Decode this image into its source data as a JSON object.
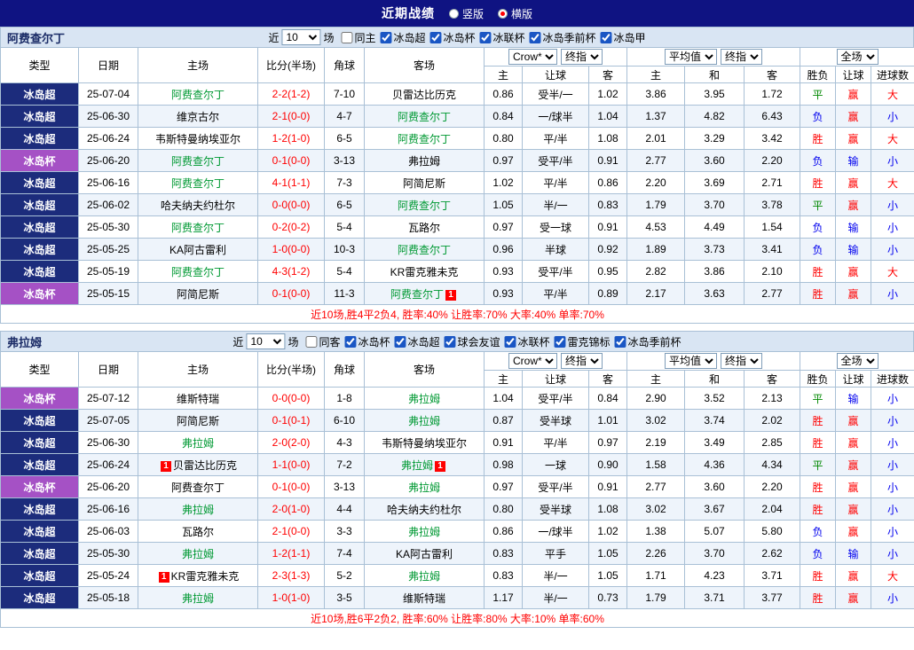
{
  "colors": {
    "topbar_bg": "#0f1382",
    "section_bar_bg": "#d9e5f3",
    "grid_border": "#a9c0d6",
    "row_alt_bg": "#eef4fb",
    "league_super_bg": "#1c2c7c",
    "league_cup_bg": "#a551c5",
    "team_green": "#009933",
    "red": "#ff0000",
    "green": "#008800",
    "blue": "#0000ee"
  },
  "top_bar": {
    "title": "近期战绩",
    "options": [
      {
        "label": "竖版",
        "selected": false
      },
      {
        "label": "横版",
        "selected": true
      }
    ]
  },
  "labels": {
    "near": "近",
    "games": "场"
  },
  "table_header": {
    "type": "类型",
    "date": "日期",
    "home": "主场",
    "score": "比分(半场)",
    "corner": "角球",
    "away": "客场",
    "ah_home": "主",
    "ah_line": "让球",
    "ah_away": "客",
    "eu_home": "主",
    "eu_draw": "和",
    "eu_away": "客",
    "result": "胜负",
    "handicap_result": "让球",
    "goals": "进球数",
    "selects": {
      "ah_company": "Crow*",
      "ah_stage": "终指",
      "eu_company": "平均值",
      "eu_stage": "终指",
      "scope": "全场"
    }
  },
  "sections": [
    {
      "team": "阿费查尔丁",
      "filter": {
        "count": "10",
        "checkboxes": [
          {
            "label": "同主",
            "checked": false
          },
          {
            "label": "冰岛超",
            "checked": true
          },
          {
            "label": "冰岛杯",
            "checked": true
          },
          {
            "label": "冰联杯",
            "checked": true
          },
          {
            "label": "冰岛季前杯",
            "checked": true
          },
          {
            "label": "冰岛甲",
            "checked": true
          }
        ]
      },
      "rows": [
        {
          "league": "冰岛超",
          "league_type": "super",
          "date": "25-07-04",
          "home": "阿费查尔丁",
          "home_team": true,
          "home_card": "",
          "score": "2-2(1-2)",
          "corner": "7-10",
          "away": "贝雷达比历克",
          "away_team": false,
          "away_card": "",
          "ah": [
            "0.86",
            "受半/一",
            "1.02"
          ],
          "eu": [
            "3.86",
            "3.95",
            "1.72"
          ],
          "res": [
            "平",
            "赢",
            "大"
          ]
        },
        {
          "league": "冰岛超",
          "league_type": "super",
          "date": "25-06-30",
          "home": "维京古尔",
          "home_team": false,
          "home_card": "",
          "score": "2-1(0-0)",
          "corner": "4-7",
          "away": "阿费查尔丁",
          "away_team": true,
          "away_card": "",
          "ah": [
            "0.84",
            "一/球半",
            "1.04"
          ],
          "eu": [
            "1.37",
            "4.82",
            "6.43"
          ],
          "res": [
            "负",
            "赢",
            "小"
          ]
        },
        {
          "league": "冰岛超",
          "league_type": "super",
          "date": "25-06-24",
          "home": "韦斯特曼纳埃亚尔",
          "home_team": false,
          "home_card": "",
          "score": "1-2(1-0)",
          "corner": "6-5",
          "away": "阿费查尔丁",
          "away_team": true,
          "away_card": "",
          "ah": [
            "0.80",
            "平/半",
            "1.08"
          ],
          "eu": [
            "2.01",
            "3.29",
            "3.42"
          ],
          "res": [
            "胜",
            "赢",
            "大"
          ]
        },
        {
          "league": "冰岛杯",
          "league_type": "cup",
          "date": "25-06-20",
          "home": "阿费查尔丁",
          "home_team": true,
          "home_card": "",
          "score": "0-1(0-0)",
          "corner": "3-13",
          "away": "弗拉姆",
          "away_team": false,
          "away_card": "",
          "ah": [
            "0.97",
            "受平/半",
            "0.91"
          ],
          "eu": [
            "2.77",
            "3.60",
            "2.20"
          ],
          "res": [
            "负",
            "输",
            "小"
          ]
        },
        {
          "league": "冰岛超",
          "league_type": "super",
          "date": "25-06-16",
          "home": "阿费查尔丁",
          "home_team": true,
          "home_card": "",
          "score": "4-1(1-1)",
          "corner": "7-3",
          "away": "阿简尼斯",
          "away_team": false,
          "away_card": "",
          "ah": [
            "1.02",
            "平/半",
            "0.86"
          ],
          "eu": [
            "2.20",
            "3.69",
            "2.71"
          ],
          "res": [
            "胜",
            "赢",
            "大"
          ]
        },
        {
          "league": "冰岛超",
          "league_type": "super",
          "date": "25-06-02",
          "home": "哈夫纳夫约杜尔",
          "home_team": false,
          "home_card": "",
          "score": "0-0(0-0)",
          "corner": "6-5",
          "away": "阿费查尔丁",
          "away_team": true,
          "away_card": "",
          "ah": [
            "1.05",
            "半/一",
            "0.83"
          ],
          "eu": [
            "1.79",
            "3.70",
            "3.78"
          ],
          "res": [
            "平",
            "赢",
            "小"
          ]
        },
        {
          "league": "冰岛超",
          "league_type": "super",
          "date": "25-05-30",
          "home": "阿费查尔丁",
          "home_team": true,
          "home_card": "",
          "score": "0-2(0-2)",
          "corner": "5-4",
          "away": "瓦路尔",
          "away_team": false,
          "away_card": "",
          "ah": [
            "0.97",
            "受一球",
            "0.91"
          ],
          "eu": [
            "4.53",
            "4.49",
            "1.54"
          ],
          "res": [
            "负",
            "输",
            "小"
          ]
        },
        {
          "league": "冰岛超",
          "league_type": "super",
          "date": "25-05-25",
          "home": "KA阿古雷利",
          "home_team": false,
          "home_card": "",
          "score": "1-0(0-0)",
          "corner": "10-3",
          "away": "阿费查尔丁",
          "away_team": true,
          "away_card": "",
          "ah": [
            "0.96",
            "半球",
            "0.92"
          ],
          "eu": [
            "1.89",
            "3.73",
            "3.41"
          ],
          "res": [
            "负",
            "输",
            "小"
          ]
        },
        {
          "league": "冰岛超",
          "league_type": "super",
          "date": "25-05-19",
          "home": "阿费查尔丁",
          "home_team": true,
          "home_card": "",
          "score": "4-3(1-2)",
          "corner": "5-4",
          "away": "KR雷克雅未克",
          "away_team": false,
          "away_card": "",
          "ah": [
            "0.93",
            "受平/半",
            "0.95"
          ],
          "eu": [
            "2.82",
            "3.86",
            "2.10"
          ],
          "res": [
            "胜",
            "赢",
            "大"
          ]
        },
        {
          "league": "冰岛杯",
          "league_type": "cup",
          "date": "25-05-15",
          "home": "阿简尼斯",
          "home_team": false,
          "home_card": "",
          "score": "0-1(0-0)",
          "corner": "11-3",
          "away": "阿费查尔丁",
          "away_team": true,
          "away_card": "1",
          "ah": [
            "0.93",
            "平/半",
            "0.89"
          ],
          "eu": [
            "2.17",
            "3.63",
            "2.77"
          ],
          "res": [
            "胜",
            "赢",
            "小"
          ]
        }
      ],
      "summary": "近10场,胜4平2负4, 胜率:40% 让胜率:70% 大率:40% 单率:70%"
    },
    {
      "team": "弗拉姆",
      "filter": {
        "count": "10",
        "checkboxes": [
          {
            "label": "同客",
            "checked": false
          },
          {
            "label": "冰岛杯",
            "checked": true
          },
          {
            "label": "冰岛超",
            "checked": true
          },
          {
            "label": "球会友谊",
            "checked": true
          },
          {
            "label": "冰联杯",
            "checked": true
          },
          {
            "label": "雷克锦标",
            "checked": true
          },
          {
            "label": "冰岛季前杯",
            "checked": true
          }
        ]
      },
      "rows": [
        {
          "league": "冰岛杯",
          "league_type": "cup",
          "date": "25-07-12",
          "home": "维斯特瑞",
          "home_team": false,
          "home_card": "",
          "score": "0-0(0-0)",
          "corner": "1-8",
          "away": "弗拉姆",
          "away_team": true,
          "away_card": "",
          "ah": [
            "1.04",
            "受平/半",
            "0.84"
          ],
          "eu": [
            "2.90",
            "3.52",
            "2.13"
          ],
          "res": [
            "平",
            "输",
            "小"
          ]
        },
        {
          "league": "冰岛超",
          "league_type": "super",
          "date": "25-07-05",
          "home": "阿简尼斯",
          "home_team": false,
          "home_card": "",
          "score": "0-1(0-1)",
          "corner": "6-10",
          "away": "弗拉姆",
          "away_team": true,
          "away_card": "",
          "ah": [
            "0.87",
            "受半球",
            "1.01"
          ],
          "eu": [
            "3.02",
            "3.74",
            "2.02"
          ],
          "res": [
            "胜",
            "赢",
            "小"
          ]
        },
        {
          "league": "冰岛超",
          "league_type": "super",
          "date": "25-06-30",
          "home": "弗拉姆",
          "home_team": true,
          "home_card": "",
          "score": "2-0(2-0)",
          "corner": "4-3",
          "away": "韦斯特曼纳埃亚尔",
          "away_team": false,
          "away_card": "",
          "ah": [
            "0.91",
            "平/半",
            "0.97"
          ],
          "eu": [
            "2.19",
            "3.49",
            "2.85"
          ],
          "res": [
            "胜",
            "赢",
            "小"
          ]
        },
        {
          "league": "冰岛超",
          "league_type": "super",
          "date": "25-06-24",
          "home": "贝雷达比历克",
          "home_team": false,
          "home_card": "1",
          "score": "1-1(0-0)",
          "corner": "7-2",
          "away": "弗拉姆",
          "away_team": true,
          "away_card": "1",
          "ah": [
            "0.98",
            "一球",
            "0.90"
          ],
          "eu": [
            "1.58",
            "4.36",
            "4.34"
          ],
          "res": [
            "平",
            "赢",
            "小"
          ]
        },
        {
          "league": "冰岛杯",
          "league_type": "cup",
          "date": "25-06-20",
          "home": "阿费查尔丁",
          "home_team": false,
          "home_card": "",
          "score": "0-1(0-0)",
          "corner": "3-13",
          "away": "弗拉姆",
          "away_team": true,
          "away_card": "",
          "ah": [
            "0.97",
            "受平/半",
            "0.91"
          ],
          "eu": [
            "2.77",
            "3.60",
            "2.20"
          ],
          "res": [
            "胜",
            "赢",
            "小"
          ]
        },
        {
          "league": "冰岛超",
          "league_type": "super",
          "date": "25-06-16",
          "home": "弗拉姆",
          "home_team": true,
          "home_card": "",
          "score": "2-0(1-0)",
          "corner": "4-4",
          "away": "哈夫纳夫约杜尔",
          "away_team": false,
          "away_card": "",
          "ah": [
            "0.80",
            "受半球",
            "1.08"
          ],
          "eu": [
            "3.02",
            "3.67",
            "2.04"
          ],
          "res": [
            "胜",
            "赢",
            "小"
          ]
        },
        {
          "league": "冰岛超",
          "league_type": "super",
          "date": "25-06-03",
          "home": "瓦路尔",
          "home_team": false,
          "home_card": "",
          "score": "2-1(0-0)",
          "corner": "3-3",
          "away": "弗拉姆",
          "away_team": true,
          "away_card": "",
          "ah": [
            "0.86",
            "一/球半",
            "1.02"
          ],
          "eu": [
            "1.38",
            "5.07",
            "5.80"
          ],
          "res": [
            "负",
            "赢",
            "小"
          ]
        },
        {
          "league": "冰岛超",
          "league_type": "super",
          "date": "25-05-30",
          "home": "弗拉姆",
          "home_team": true,
          "home_card": "",
          "score": "1-2(1-1)",
          "corner": "7-4",
          "away": "KA阿古雷利",
          "away_team": false,
          "away_card": "",
          "ah": [
            "0.83",
            "平手",
            "1.05"
          ],
          "eu": [
            "2.26",
            "3.70",
            "2.62"
          ],
          "res": [
            "负",
            "输",
            "小"
          ]
        },
        {
          "league": "冰岛超",
          "league_type": "super",
          "date": "25-05-24",
          "home": "KR雷克雅未克",
          "home_team": false,
          "home_card": "1",
          "score": "2-3(1-3)",
          "corner": "5-2",
          "away": "弗拉姆",
          "away_team": true,
          "away_card": "",
          "ah": [
            "0.83",
            "半/一",
            "1.05"
          ],
          "eu": [
            "1.71",
            "4.23",
            "3.71"
          ],
          "res": [
            "胜",
            "赢",
            "大"
          ]
        },
        {
          "league": "冰岛超",
          "league_type": "super",
          "date": "25-05-18",
          "home": "弗拉姆",
          "home_team": true,
          "home_card": "",
          "score": "1-0(1-0)",
          "corner": "3-5",
          "away": "维斯特瑞",
          "away_team": false,
          "away_card": "",
          "ah": [
            "1.17",
            "半/一",
            "0.73"
          ],
          "eu": [
            "1.79",
            "3.71",
            "3.77"
          ],
          "res": [
            "胜",
            "赢",
            "小"
          ]
        }
      ],
      "summary": "近10场,胜6平2负2, 胜率:60% 让胜率:80% 大率:10% 单率:60%"
    }
  ]
}
